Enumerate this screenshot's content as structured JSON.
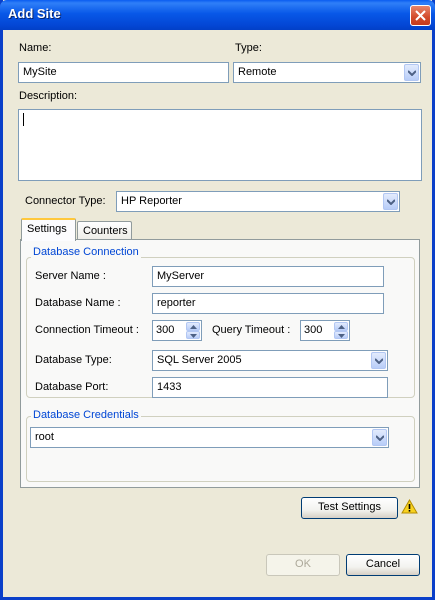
{
  "window": {
    "title": "Add Site"
  },
  "form": {
    "name_label": "Name:",
    "name_value": "MySite",
    "type_label": "Type:",
    "type_value": "Remote",
    "description_label": "Description:",
    "description_value": "",
    "connector_label": "Connector Type:",
    "connector_value": "HP Reporter"
  },
  "tabs": [
    {
      "label": "Settings",
      "active": true
    },
    {
      "label": "Counters",
      "active": false
    }
  ],
  "db_connection": {
    "title": "Database Connection",
    "server_label": "Server Name :",
    "server_value": "MyServer",
    "dbname_label": "Database Name :",
    "dbname_value": "reporter",
    "conn_timeout_label": "Connection Timeout :",
    "conn_timeout_value": "300",
    "query_timeout_label": "Query Timeout :",
    "query_timeout_value": "300",
    "dbtype_label": "Database Type:",
    "dbtype_value": "SQL Server 2005",
    "port_label": "Database Port:",
    "port_value": "1433"
  },
  "db_credentials": {
    "title": "Database Credentials",
    "value": "root"
  },
  "buttons": {
    "test_settings": "Test Settings",
    "ok": "OK",
    "cancel": "Cancel"
  },
  "icons": {
    "warning": "warning-icon",
    "close": "close-icon"
  }
}
